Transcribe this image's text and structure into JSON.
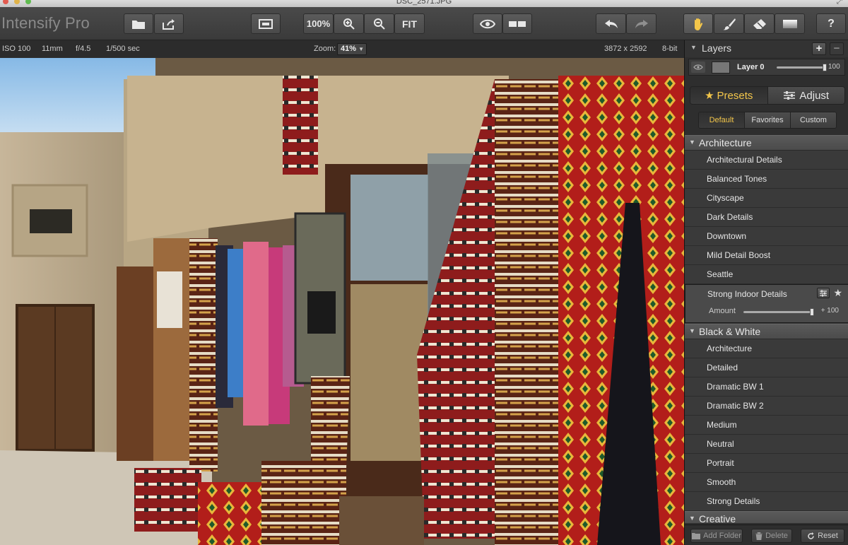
{
  "window": {
    "title": "DSC_2571.JPG"
  },
  "app": {
    "name": "Intensify Pro"
  },
  "toolbar": {
    "zoom_100_label": "100%",
    "fit_label": "FIT",
    "help_label": "?"
  },
  "info": {
    "iso": "ISO 100",
    "focal": "11mm",
    "aperture": "f/4.5",
    "shutter": "1/500 sec",
    "zoom_label": "Zoom:",
    "zoom_value": "41%",
    "dimensions": "3872 x 2592",
    "bit_depth": "8-bit"
  },
  "layers": {
    "title": "Layers",
    "add_label": "+",
    "remove_label": "−",
    "layer_name": "Layer 0",
    "opacity": "100",
    "opacity_fraction": 1.0
  },
  "mode_tabs": [
    {
      "label": "Presets",
      "active": true
    },
    {
      "label": "Adjust",
      "active": false
    }
  ],
  "preset_tabs": [
    {
      "label": "Default",
      "active": true
    },
    {
      "label": "Favorites",
      "active": false
    },
    {
      "label": "Custom",
      "active": false
    }
  ],
  "categories": [
    {
      "name": "Architecture",
      "items": [
        "Architectural Details",
        "Balanced Tones",
        "Cityscape",
        "Dark Details",
        "Downtown",
        "Mild Detail Boost",
        "Seattle",
        "Strong Indoor Details"
      ]
    },
    {
      "name": "Black & White",
      "items": [
        "Architecture",
        "Detailed",
        "Dramatic BW 1",
        "Dramatic BW 2",
        "Medium",
        "Neutral",
        "Portrait",
        "Smooth",
        "Strong Details"
      ]
    },
    {
      "name": "Creative",
      "items": []
    }
  ],
  "selected_preset": {
    "name": "Strong Indoor Details",
    "amount_label": "Amount",
    "amount_value": "+ 100",
    "amount_fraction": 1.0
  },
  "footer": {
    "add_folder": "Add Folder",
    "delete": "Delete",
    "reset": "Reset"
  },
  "colors": {
    "accent": "#f3c64a",
    "toolbar_bg": "#404040",
    "panel_bg": "#3a3a3a"
  }
}
